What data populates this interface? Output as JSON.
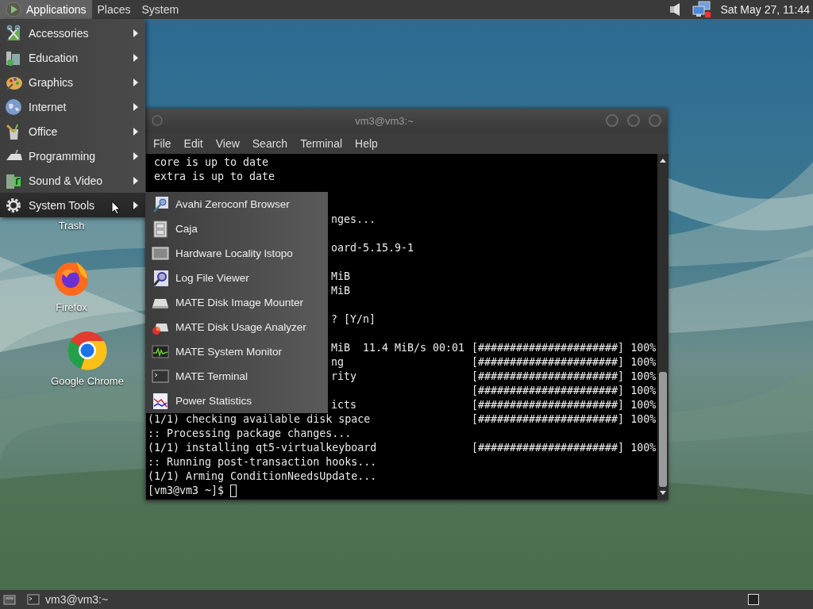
{
  "top_panel": {
    "menus": [
      {
        "label": "Applications",
        "selected": true
      },
      {
        "label": "Places",
        "selected": false
      },
      {
        "label": "System",
        "selected": false
      }
    ],
    "clock": "Sat May 27, 11:44"
  },
  "desktop": {
    "icons": [
      {
        "label": "Trash",
        "kind": "trash"
      },
      {
        "label": "Firefox",
        "kind": "firefox"
      },
      {
        "label": "Google Chrome",
        "kind": "chrome"
      }
    ]
  },
  "terminal": {
    "title": "vm3@vm3:~",
    "menus": [
      "File",
      "Edit",
      "View",
      "Search",
      "Terminal",
      "Help"
    ],
    "lines": [
      {
        "kind": "text",
        "text": " core is up to date"
      },
      {
        "kind": "text",
        "text": " extra is up to date"
      },
      {
        "kind": "blank"
      },
      {
        "kind": "blank"
      },
      {
        "kind": "text",
        "covered": true,
        "text": "nges..."
      },
      {
        "kind": "blank"
      },
      {
        "kind": "text",
        "covered": true,
        "text": "oard-5.15.9-1"
      },
      {
        "kind": "blank"
      },
      {
        "kind": "text",
        "covered": true,
        "text": "MiB"
      },
      {
        "kind": "text",
        "covered": true,
        "text": "MiB"
      },
      {
        "kind": "blank"
      },
      {
        "kind": "text",
        "covered": true,
        "text": "? [Y/n]"
      },
      {
        "kind": "blank"
      },
      {
        "kind": "text",
        "covered": true,
        "text": "MiB  11.4 MiB/s 00:01",
        "progress": "[######################] 100%"
      },
      {
        "kind": "text",
        "covered": true,
        "text": "ng",
        "progress": "[######################] 100%"
      },
      {
        "kind": "text",
        "covered": true,
        "text": "rity",
        "progress": "[######################] 100%"
      },
      {
        "kind": "text",
        "covered": true,
        "progress": "[######################] 100%"
      },
      {
        "kind": "text",
        "covered": true,
        "text": "icts",
        "progress": "[######################] 100%"
      },
      {
        "kind": "text",
        "text": "(1/1) checking available disk space",
        "progress": "[######################] 100%"
      },
      {
        "kind": "text",
        "text": ":: Processing package changes..."
      },
      {
        "kind": "text",
        "text": "(1/1) installing qt5-virtualkeyboard",
        "progress": "[######################] 100%"
      },
      {
        "kind": "text",
        "text": ":: Running post-transaction hooks..."
      },
      {
        "kind": "text",
        "text": "(1/1) Arming ConditionNeedsUpdate..."
      }
    ],
    "prompt": "[vm3@vm3 ~]$"
  },
  "applications_menu": {
    "items": [
      {
        "label": "Accessories",
        "kind": "accessories",
        "selected": false
      },
      {
        "label": "Education",
        "kind": "education",
        "selected": false
      },
      {
        "label": "Graphics",
        "kind": "graphics",
        "selected": false
      },
      {
        "label": "Internet",
        "kind": "internet",
        "selected": false
      },
      {
        "label": "Office",
        "kind": "office",
        "selected": false
      },
      {
        "label": "Programming",
        "kind": "programming",
        "selected": false
      },
      {
        "label": "Sound & Video",
        "kind": "sound",
        "selected": false
      },
      {
        "label": "System Tools",
        "kind": "system",
        "selected": true
      }
    ]
  },
  "submenu": {
    "items": [
      {
        "label": "Avahi Zeroconf Browser",
        "kind": "avahi"
      },
      {
        "label": "Caja",
        "kind": "cabinet"
      },
      {
        "label": "Hardware Locality lstopo",
        "kind": "hardware"
      },
      {
        "label": "Log File Viewer",
        "kind": "log"
      },
      {
        "label": "MATE Disk Image Mounter",
        "kind": "disk"
      },
      {
        "label": "MATE Disk Usage Analyzer",
        "kind": "usage"
      },
      {
        "label": "MATE System Monitor",
        "kind": "monitor"
      },
      {
        "label": "MATE Terminal",
        "kind": "terminal"
      },
      {
        "label": "Power Statistics",
        "kind": "power"
      }
    ]
  },
  "bottom_panel": {
    "tasks": [
      {
        "label": "vm3@vm3:~"
      }
    ]
  }
}
